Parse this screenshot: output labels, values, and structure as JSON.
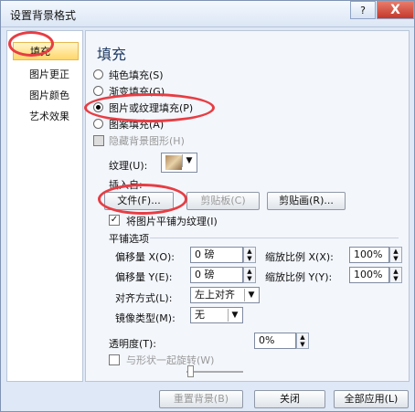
{
  "window": {
    "title": "设置背景格式",
    "help": "?",
    "close": "X"
  },
  "sidebar": {
    "items": [
      {
        "label": "填充"
      },
      {
        "label": "图片更正"
      },
      {
        "label": "图片颜色"
      },
      {
        "label": "艺术效果"
      }
    ]
  },
  "panel": {
    "title": "填充",
    "radios": [
      {
        "label": "纯色填充(S)"
      },
      {
        "label": "渐变填充(G)"
      },
      {
        "label": "图片或纹理填充(P)"
      },
      {
        "label": "图案填充(A)"
      }
    ],
    "hide_bg_label": "隐藏背景图形(H)",
    "texture_label": "纹理(U):",
    "insert_from_label": "插入自:",
    "file_button": "文件(F)...",
    "clipboard_button": "剪贴板(C)",
    "clipart_button": "剪贴画(R)...",
    "tile_label": "将图片平铺为纹理(I)",
    "tile_options": "平铺选项",
    "offset_x_label": "偏移量 X(O):",
    "offset_x_value": "0 磅",
    "offset_y_label": "偏移量 Y(E):",
    "offset_y_value": "0 磅",
    "scale_x_label": "缩放比例 X(X):",
    "scale_x_value": "100%",
    "scale_y_label": "缩放比例 Y(Y):",
    "scale_y_value": "100%",
    "align_label": "对齐方式(L):",
    "align_value": "左上对齐",
    "mirror_label": "镜像类型(M):",
    "mirror_value": "无",
    "transparency_label": "透明度(T):",
    "transparency_value": "0%",
    "rotate_label": "与形状一起旋转(W)"
  },
  "footer": {
    "reset": "重置背景(B)",
    "close": "关闭",
    "apply_all": "全部应用(L)"
  },
  "colors": {
    "accent": "#e73d43",
    "sidebar_selected": "#ffd76b"
  }
}
